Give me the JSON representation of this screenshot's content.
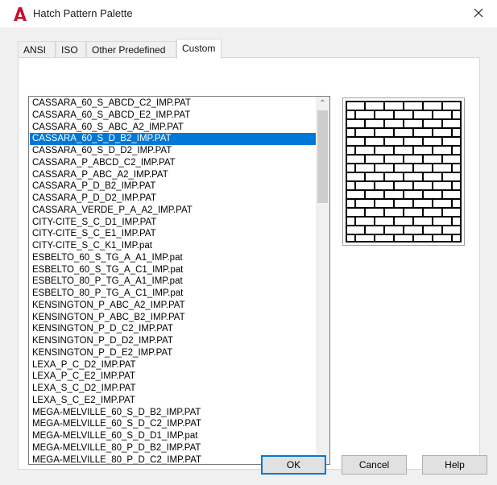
{
  "window": {
    "title": "Hatch Pattern Palette",
    "icon": "autocad-a-icon",
    "accent": "#0078d7",
    "brand": "#c8102e"
  },
  "tabs": [
    {
      "label": "ANSI",
      "active": false
    },
    {
      "label": "ISO",
      "active": false
    },
    {
      "label": "Other Predefined",
      "active": false
    },
    {
      "label": "Custom",
      "active": true
    }
  ],
  "patterns": {
    "items": [
      "CASSARA_60_S_ABCD_C2_IMP.PAT",
      "CASSARA_60_S_ABCD_E2_IMP.PAT",
      "CASSARA_60_S_ABC_A2_IMP.PAT",
      "CASSARA_60_S_D_B2_IMP.PAT",
      "CASSARA_60_S_D_D2_IMP.PAT",
      "CASSARA_P_ABCD_C2_IMP.PAT",
      "CASSARA_P_ABC_A2_IMP.PAT",
      "CASSARA_P_D_B2_IMP.PAT",
      "CASSARA_P_D_D2_IMP.PAT",
      "CASSARA_VERDE_P_A_A2_IMP.PAT",
      "CITY-CITE_S_C_D1_IMP.PAT",
      "CITY-CITE_S_C_E1_IMP.PAT",
      "CITY-CITE_S_C_K1_IMP.pat",
      "ESBELTO_60_S_TG_A_A1_IMP.pat",
      "ESBELTO_60_S_TG_A_C1_IMP.pat",
      "ESBELTO_80_P_TG_A_A1_IMP.pat",
      "ESBELTO_80_P_TG_A_C1_IMP.pat",
      "KENSINGTON_P_ABC_A2_IMP.PAT",
      "KENSINGTON_P_ABC_B2_IMP.PAT",
      "KENSINGTON_P_D_C2_IMP.PAT",
      "KENSINGTON_P_D_D2_IMP.PAT",
      "KENSINGTON_P_D_E2_IMP.PAT",
      "LEXA_P_C_D2_IMP.PAT",
      "LEXA_P_C_E2_IMP.PAT",
      "LEXA_S_C_D2_IMP.PAT",
      "LEXA_S_C_E2_IMP.PAT",
      "MEGA-MELVILLE_60_S_D_B2_IMP.PAT",
      "MEGA-MELVILLE_60_S_D_C2_IMP.PAT",
      "MEGA-MELVILLE_60_S_D_D1_IMP.pat",
      "MEGA-MELVILLE_80_P_D_B2_IMP.PAT",
      "MEGA-MELVILLE_80_P_D_C2_IMP.PAT"
    ],
    "selected_index": 3,
    "scroll_position": 0.05
  },
  "preview": {
    "pattern": "brick-pattern",
    "line_color": "#000000"
  },
  "buttons": {
    "ok": "OK",
    "cancel": "Cancel",
    "help": "Help"
  }
}
